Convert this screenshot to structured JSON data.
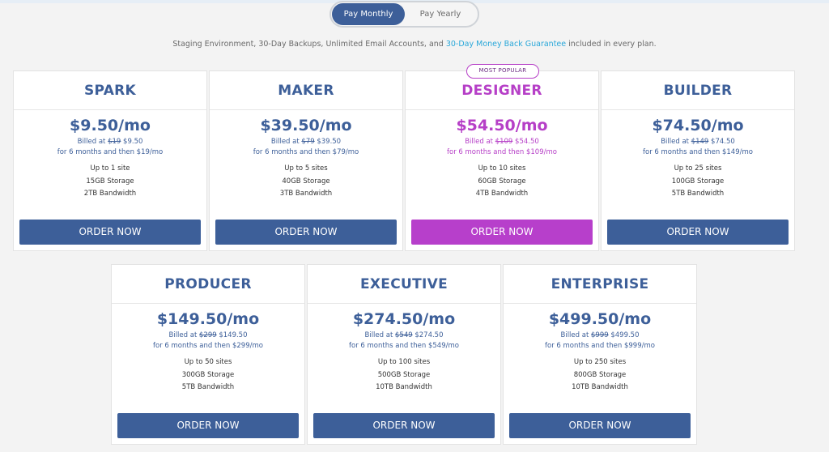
{
  "billing_toggle": {
    "monthly": "Pay Monthly",
    "yearly": "Pay Yearly"
  },
  "note": {
    "prefix": "Staging Environment, 30-Day Backups, Unlimited Email Accounts, and ",
    "link": "30-Day Money Back Guarantee",
    "suffix": " included in every plan."
  },
  "badge": "MOST POPULAR",
  "plans": [
    {
      "name": "SPARK",
      "price": "$9.50/mo",
      "billed_prefix": "Billed at ",
      "old": "$19",
      "new": " $9.50",
      "term": "for 6 months and then $19/mo",
      "sites": "Up to 1 site",
      "storage": "15GB Storage",
      "bandwidth": "2TB Bandwidth",
      "cta": "ORDER NOW"
    },
    {
      "name": "MAKER",
      "price": "$39.50/mo",
      "billed_prefix": "Billed at ",
      "old": "$79",
      "new": " $39.50",
      "term": "for 6 months and then $79/mo",
      "sites": "Up to 5 sites",
      "storage": "40GB Storage",
      "bandwidth": "3TB Bandwidth",
      "cta": "ORDER NOW"
    },
    {
      "name": "DESIGNER",
      "price": "$54.50/mo",
      "billed_prefix": "Billed at ",
      "old": "$109",
      "new": " $54.50",
      "term": "for 6 months and then $109/mo",
      "sites": "Up to 10 sites",
      "storage": "60GB Storage",
      "bandwidth": "4TB Bandwidth",
      "cta": "ORDER NOW"
    },
    {
      "name": "BUILDER",
      "price": "$74.50/mo",
      "billed_prefix": "Billed at ",
      "old": "$149",
      "new": " $74.50",
      "term": "for 6 months and then $149/mo",
      "sites": "Up to 25 sites",
      "storage": "100GB Storage",
      "bandwidth": "5TB Bandwidth",
      "cta": "ORDER NOW"
    },
    {
      "name": "PRODUCER",
      "price": "$149.50/mo",
      "billed_prefix": "Billed at ",
      "old": "$299",
      "new": " $149.50",
      "term": "for 6 months and then $299/mo",
      "sites": "Up to 50 sites",
      "storage": "300GB Storage",
      "bandwidth": "5TB Bandwidth",
      "cta": "ORDER NOW"
    },
    {
      "name": "EXECUTIVE",
      "price": "$274.50/mo",
      "billed_prefix": "Billed at ",
      "old": "$549",
      "new": " $274.50",
      "term": "for 6 months and then $549/mo",
      "sites": "Up to 100 sites",
      "storage": "500GB Storage",
      "bandwidth": "10TB Bandwidth",
      "cta": "ORDER NOW"
    },
    {
      "name": "ENTERPRISE",
      "price": "$499.50/mo",
      "billed_prefix": "Billed at ",
      "old": "$999",
      "new": " $499.50",
      "term": "for 6 months and then $999/mo",
      "sites": "Up to 250 sites",
      "storage": "800GB Storage",
      "bandwidth": "10TB Bandwidth",
      "cta": "ORDER NOW"
    }
  ],
  "colors": {
    "primary": "#3d5f99",
    "popular": "#b73fcb",
    "link": "#28a7d9"
  }
}
